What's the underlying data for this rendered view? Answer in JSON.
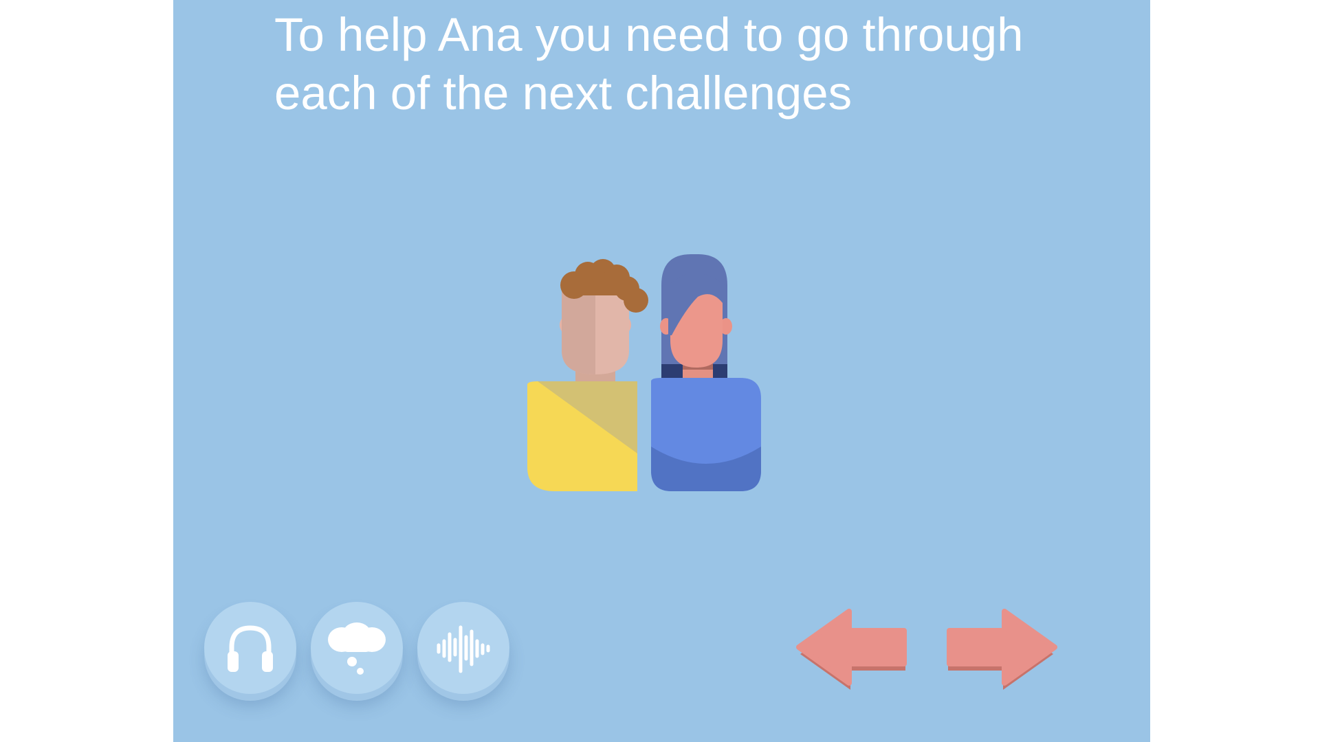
{
  "instruction": {
    "line1": "To help Ana you need to go through",
    "line2": "each of the next challenges"
  },
  "toolbar": {
    "buttons": [
      {
        "icon": "headphones-icon"
      },
      {
        "icon": "thought-bubble-icon"
      },
      {
        "icon": "sound-wave-icon"
      }
    ]
  },
  "navigation": {
    "back_icon": "arrow-left-icon",
    "next_icon": "arrow-right-icon"
  },
  "colors": {
    "background": "#9ac4e6",
    "button": "#b3d5ef",
    "arrow": "#e8918a"
  }
}
